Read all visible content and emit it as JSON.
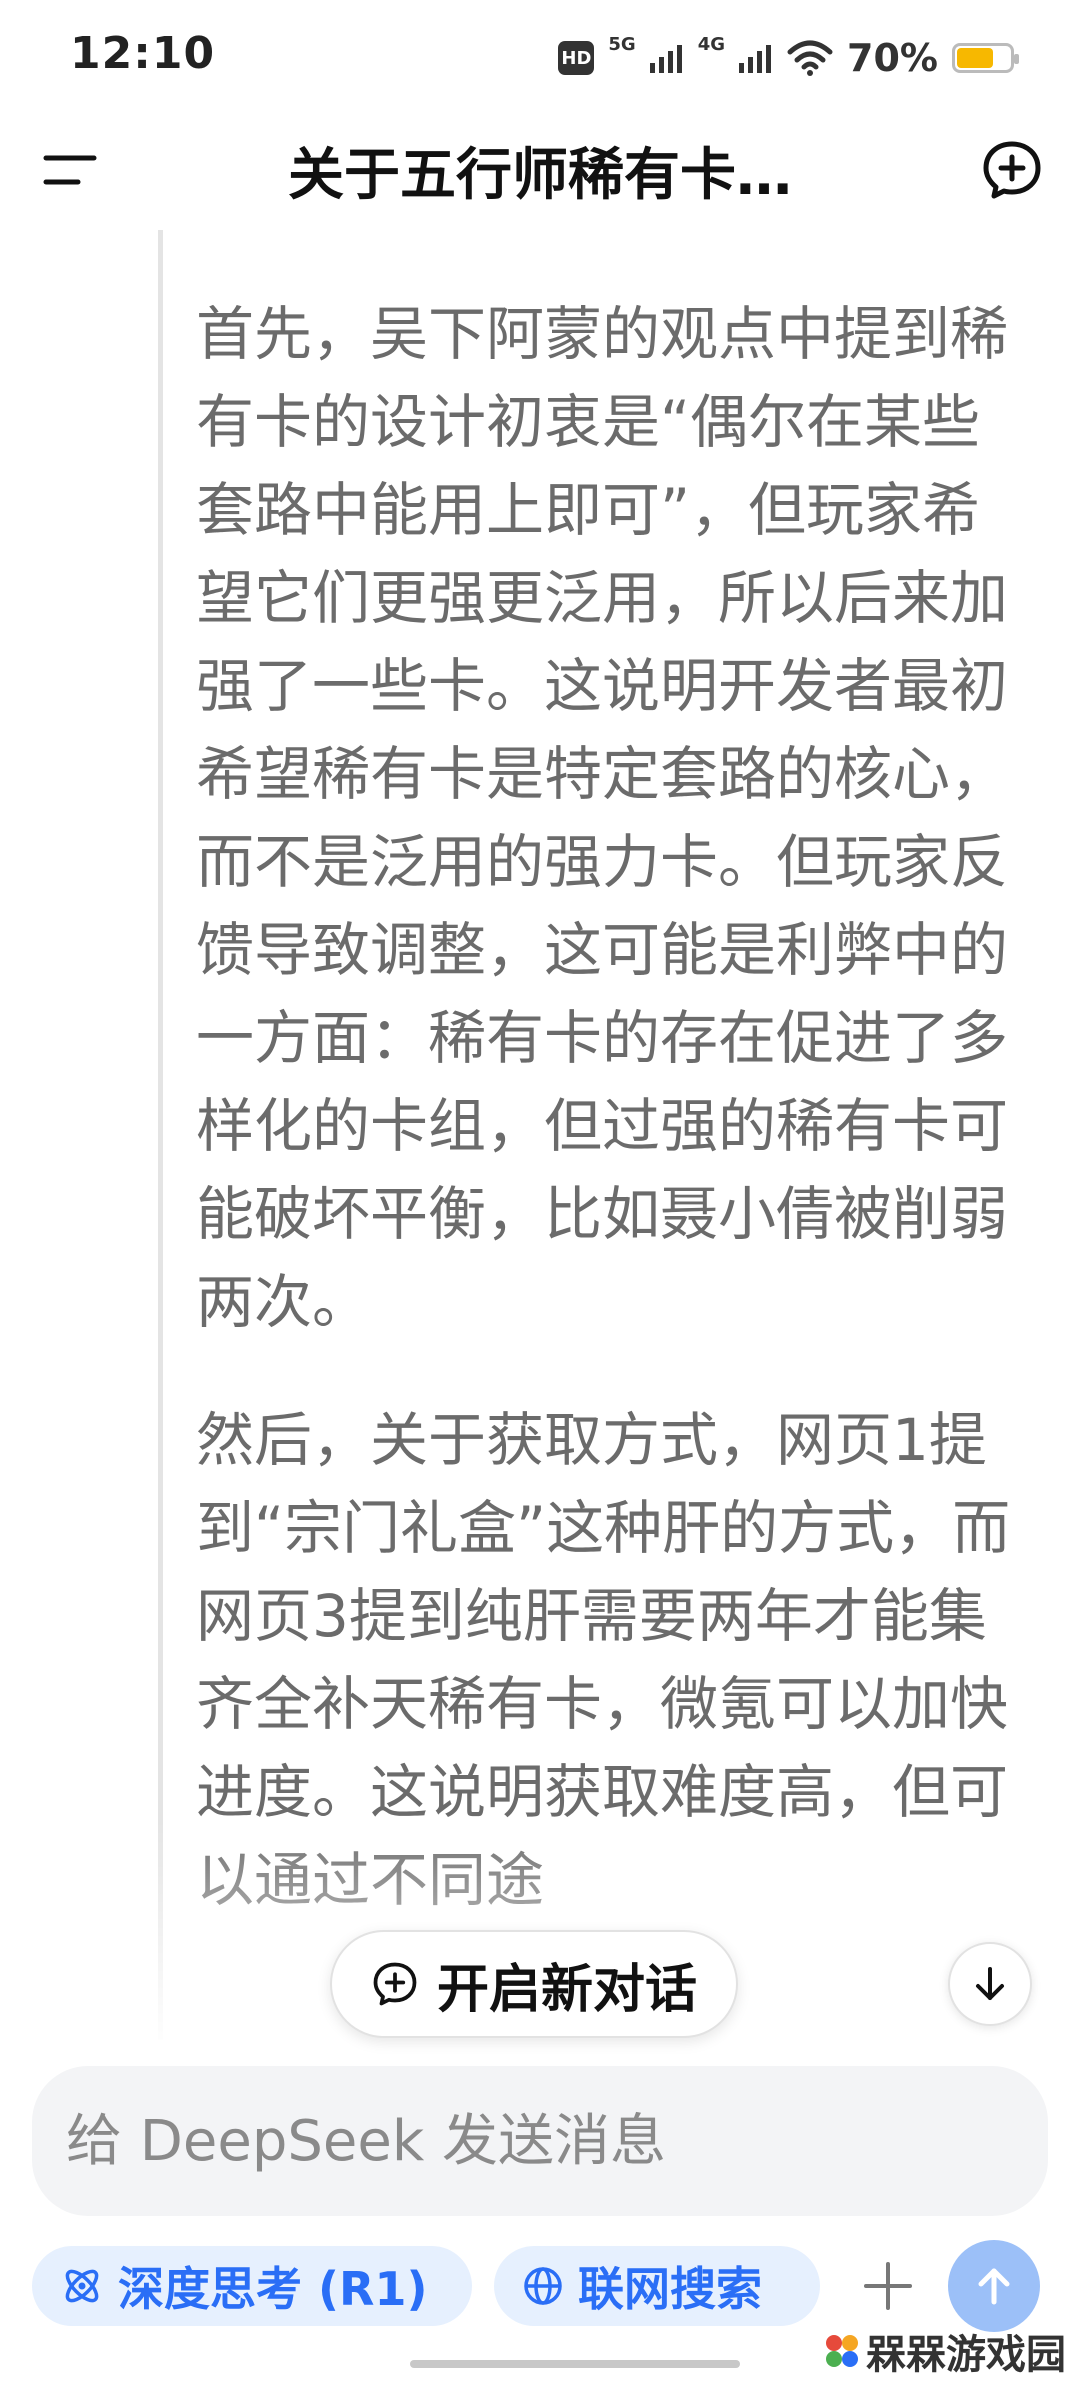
{
  "status_bar": {
    "time": "12:10",
    "hd_label": "HD",
    "sim1_label": "5G",
    "sim2_label": "4G",
    "battery_percent": "70%",
    "battery_level": 0.7,
    "battery_color": "#f7b800"
  },
  "header": {
    "title": "关于五行师稀有卡…",
    "menu_icon": "menu-icon",
    "new_chat_icon": "chat-plus-icon"
  },
  "thinking": {
    "paragraphs": [
      "首先，吴下阿蒙的观点中提到稀有卡的设计初衷是“偶尔在某些套路中能用上即可”，但玩家希望它们更强更泛用，所以后来加强了一些卡。这说明开发者最初希望稀有卡是特定套路的核心，而不是泛用的强力卡。但玩家反馈导致调整，这可能是利弊中的一方面：稀有卡的存在促进了多样化的卡组，但过强的稀有卡可能破坏平衡，比如聂小倩被削弱两次。",
      "然后，关于获取方式，网页1提到“宗门礼盒”这种肝的方式，而网页3提到纯肝需要两年才能集齐全补天稀有卡，微氪可以加快进度。这说明获取难度高，但可以通过不同途"
    ],
    "text_color": "#6b6b6b"
  },
  "floating": {
    "new_conversation_label": "开启新对话"
  },
  "input": {
    "placeholder": "给 DeepSeek 发送消息",
    "value": ""
  },
  "controls": {
    "deep_think_label": "深度思考 (R1)",
    "web_search_label": "联网搜索",
    "accent_color": "#2a6ef6",
    "pill_bg": "#e6f0fe",
    "send_color": "#9cc0f8"
  },
  "watermark": {
    "text": "槑槑游戏园"
  }
}
